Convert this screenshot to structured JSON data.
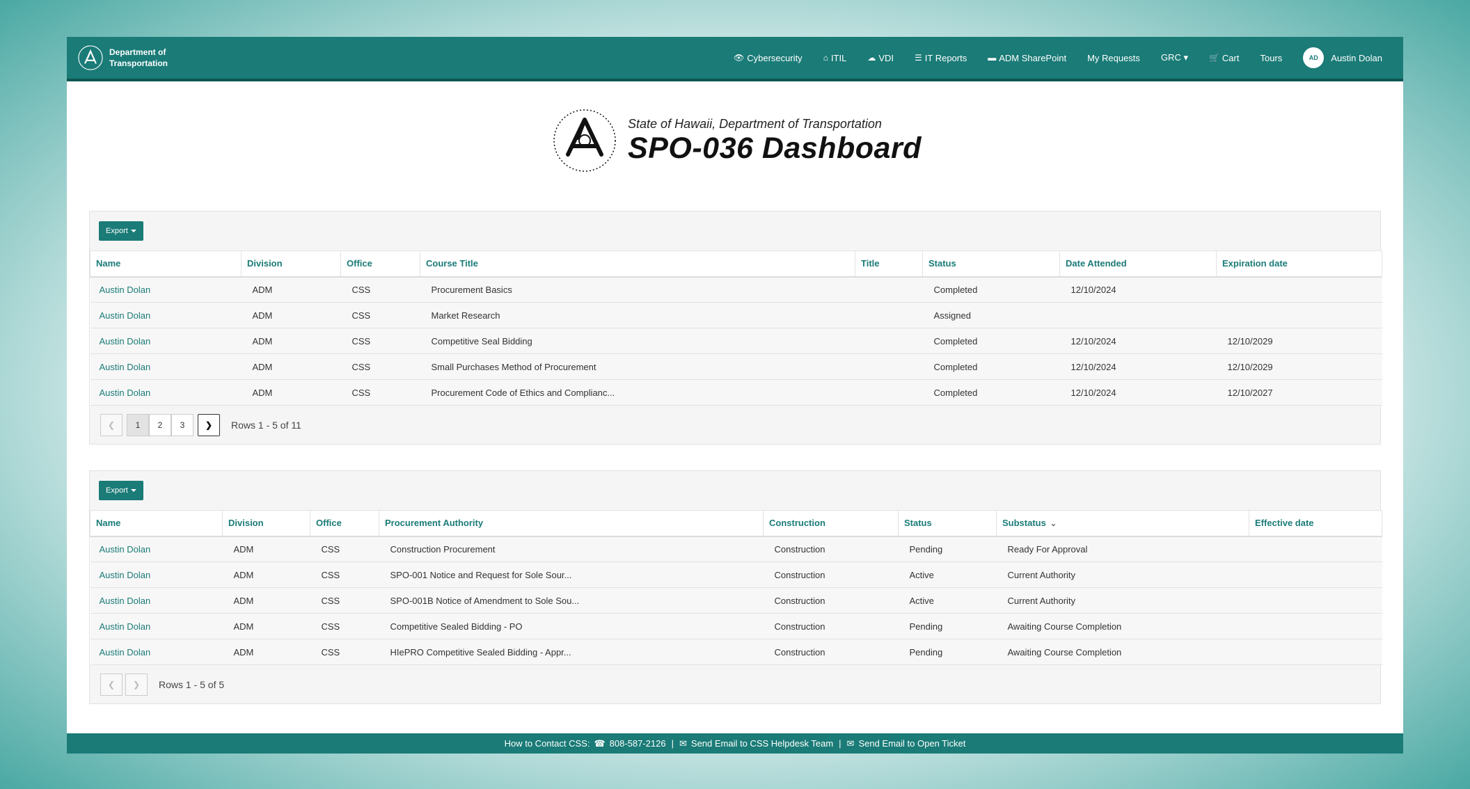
{
  "brand": {
    "line1": "Department of",
    "line2": "Transportation"
  },
  "nav": {
    "items": [
      {
        "icon": "👁",
        "label": "Cybersecurity"
      },
      {
        "icon": "⌂",
        "label": "ITIL"
      },
      {
        "icon": "☁",
        "label": "VDI"
      },
      {
        "icon": "☰",
        "label": "IT Reports"
      },
      {
        "icon": "▬",
        "label": "ADM SharePoint"
      },
      {
        "icon": "",
        "label": "My Requests"
      },
      {
        "icon": "",
        "label": "GRC ▾"
      },
      {
        "icon": "🛒",
        "label": "Cart"
      },
      {
        "icon": "",
        "label": "Tours"
      }
    ],
    "user": {
      "initials": "AD",
      "name": "Austin Dolan"
    }
  },
  "header": {
    "subtitle": "State of Hawaii, Department of Transportation",
    "title": "SPO-036 Dashboard"
  },
  "courses": {
    "export_label": "Export",
    "columns": [
      "Name",
      "Division",
      "Office",
      "Course Title",
      "Title",
      "Status",
      "Date Attended",
      "Expiration date"
    ],
    "rows": [
      [
        "Austin Dolan",
        "ADM",
        "CSS",
        "Procurement Basics",
        "",
        "Completed",
        "12/10/2024",
        ""
      ],
      [
        "Austin Dolan",
        "ADM",
        "CSS",
        "Market Research",
        "",
        "Assigned",
        "",
        ""
      ],
      [
        "Austin Dolan",
        "ADM",
        "CSS",
        "Competitive Seal Bidding",
        "",
        "Completed",
        "12/10/2024",
        "12/10/2029"
      ],
      [
        "Austin Dolan",
        "ADM",
        "CSS",
        "Small Purchases Method of Procurement",
        "",
        "Completed",
        "12/10/2024",
        "12/10/2029"
      ],
      [
        "Austin Dolan",
        "ADM",
        "CSS",
        "Procurement Code of Ethics and Complianc...",
        "",
        "Completed",
        "12/10/2024",
        "12/10/2027"
      ]
    ],
    "pages": [
      "1",
      "2",
      "3"
    ],
    "rows_info": "Rows 1 - 5 of 11"
  },
  "authority": {
    "export_label": "Export",
    "columns": [
      "Name",
      "Division",
      "Office",
      "Procurement Authority",
      "Construction",
      "Status",
      "Substatus",
      "Effective date"
    ],
    "rows": [
      [
        "Austin Dolan",
        "ADM",
        "CSS",
        "Construction Procurement",
        "Construction",
        "Pending",
        "Ready For Approval",
        ""
      ],
      [
        "Austin Dolan",
        "ADM",
        "CSS",
        "SPO-001 Notice and Request for Sole Sour...",
        "Construction",
        "Active",
        "Current Authority",
        ""
      ],
      [
        "Austin Dolan",
        "ADM",
        "CSS",
        "SPO-001B Notice of Amendment to Sole Sou...",
        "Construction",
        "Active",
        "Current Authority",
        ""
      ],
      [
        "Austin Dolan",
        "ADM",
        "CSS",
        "Competitive Sealed Bidding - PO",
        "Construction",
        "Pending",
        "Awaiting Course Completion",
        ""
      ],
      [
        "Austin Dolan",
        "ADM",
        "CSS",
        "HIePRO Competitive Sealed Bidding - Appr...",
        "Construction",
        "Pending",
        "Awaiting Course Completion",
        ""
      ]
    ],
    "rows_info": "Rows 1 - 5 of 5"
  },
  "footer": {
    "contact_label": "How to Contact CSS:",
    "phone": "808-587-2126",
    "email_helpdesk": "Send Email to CSS Helpdesk Team",
    "email_ticket": "Send Email to Open Ticket"
  },
  "colors": {
    "primary": "#1a7b77",
    "primary_dark": "#0e5552"
  }
}
